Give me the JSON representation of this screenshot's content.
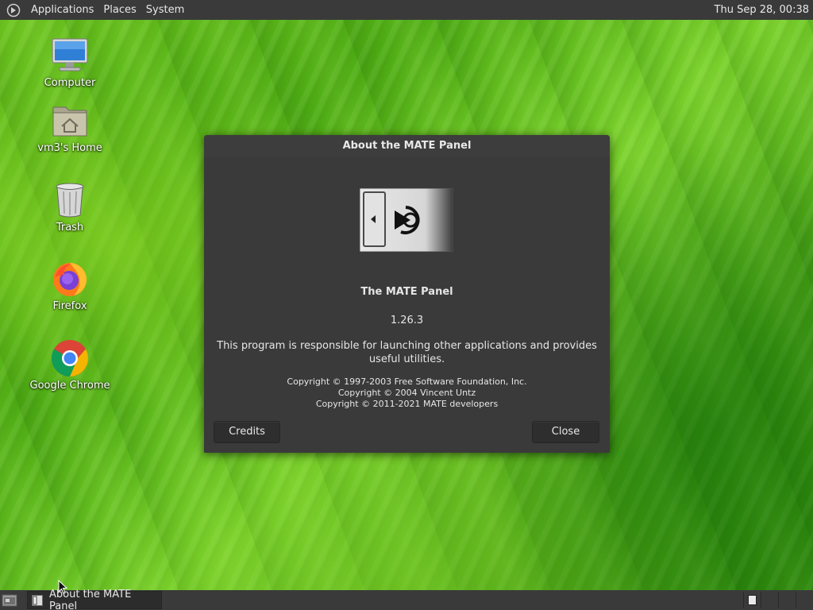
{
  "top_panel": {
    "menus": [
      "Applications",
      "Places",
      "System"
    ],
    "clock": "Thu Sep 28, 00:38"
  },
  "desktop_icons": [
    {
      "label": "Computer",
      "icon": "computer-icon"
    },
    {
      "label": "vm3's Home",
      "icon": "home-folder-icon"
    },
    {
      "label": "Trash",
      "icon": "trash-icon"
    },
    {
      "label": "Firefox",
      "icon": "firefox-icon"
    },
    {
      "label": "Google Chrome",
      "icon": "chrome-icon"
    }
  ],
  "dialog": {
    "title": "About the MATE Panel",
    "program_name": "The MATE Panel",
    "version": "1.26.3",
    "comments": "This program is responsible for launching other applications and provides useful utilities.",
    "copyright": [
      "Copyright © 1997-2003 Free Software Foundation, Inc.",
      "Copyright © 2004 Vincent Untz",
      "Copyright © 2011-2021 MATE developers"
    ],
    "credits_label": "Credits",
    "close_label": "Close"
  },
  "bottom_panel": {
    "task_label": "About the MATE Panel"
  },
  "colors": {
    "panel_bg": "#3a3a3a",
    "dialog_bg": "#3a3a3a",
    "wallpaper_green": "#5cb81a"
  }
}
